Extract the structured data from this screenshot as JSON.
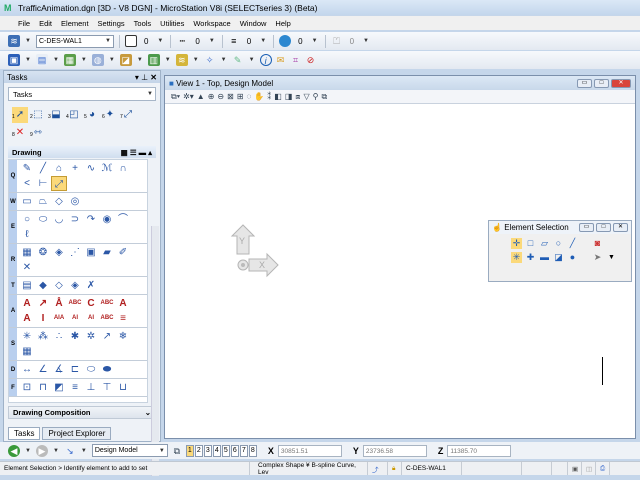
{
  "title": "TrafficAnimation.dgn [3D - V8 DGN] - MicroStation V8i (SELECTseries 3) (Beta)",
  "menu": [
    "File",
    "Edit",
    "Element",
    "Settings",
    "Tools",
    "Utilities",
    "Workspace",
    "Window",
    "Help"
  ],
  "attributes": {
    "level": "C-DES-WAL1",
    "color": "0",
    "style": "0",
    "weight": "0",
    "transparency": "0",
    "priority": "0"
  },
  "tasks_panel": {
    "title": "Tasks",
    "selected_task": "Tasks",
    "main_tools": [
      "1",
      "2",
      "3",
      "4",
      "5",
      "6",
      "7",
      "8",
      "9"
    ],
    "drawing_header": "Drawing",
    "groups": [
      {
        "key": "Q",
        "icons": [
          "✎",
          "╱",
          "⌂",
          "+",
          "∿",
          "ℳ",
          "∩",
          "<",
          "⊢",
          "⤢"
        ],
        "selected": 9
      },
      {
        "key": "W",
        "icons": [
          "▭",
          "⏢",
          "◇",
          "◎"
        ]
      },
      {
        "key": "E",
        "icons": [
          "○",
          "⬭",
          "◡",
          "⊃",
          "↷",
          "◉",
          "⌒",
          "ℓ"
        ]
      },
      {
        "key": "R",
        "icons": [
          "▦",
          "❂",
          "◈",
          "⋰",
          "▣",
          "▰",
          "✐",
          "✕"
        ]
      },
      {
        "key": "T",
        "icons": [
          "▤",
          "◆",
          "◇",
          "◈",
          "✗"
        ]
      },
      {
        "key": "A",
        "icons": [
          "A",
          "↗",
          "Å",
          "ABC",
          "C",
          "ABC",
          "A",
          "A",
          "I",
          "AIA",
          "AI",
          "AI",
          "ABC",
          "≡"
        ]
      },
      {
        "key": "S",
        "icons": [
          "✳",
          "⁂",
          "∴",
          "✱",
          "✲",
          "↗",
          "❄",
          "▦"
        ]
      },
      {
        "key": "D",
        "icons": [
          "↔",
          "∠",
          "∡",
          "⊏",
          "⬭",
          "⬬"
        ]
      },
      {
        "key": "F",
        "icons": [
          "⊡",
          "⊓",
          "◩",
          "≡",
          "⊥",
          "⊤",
          "⊔"
        ]
      }
    ],
    "drawing_composition": "Drawing Composition",
    "tabs": [
      "Tasks",
      "Project Explorer"
    ]
  },
  "view": {
    "title": "View 1 - Top, Design Model",
    "axis_y": "Y",
    "axis_x": "X"
  },
  "element_selection": {
    "title": "Element Selection"
  },
  "bottom": {
    "model": "Design Model",
    "views": [
      "1",
      "2",
      "3",
      "4",
      "5",
      "6",
      "7",
      "8"
    ],
    "active_view": "1",
    "x_label": "X",
    "x": "30851.51",
    "y_label": "Y",
    "y": "23736.58",
    "z_label": "Z",
    "z": "11385.70"
  },
  "status": {
    "prompt": "Element Selection > Identify element to add to set",
    "message": "Complex Shape ¥ B-spline Curve, Lev",
    "level": "C-DES-WAL1"
  }
}
